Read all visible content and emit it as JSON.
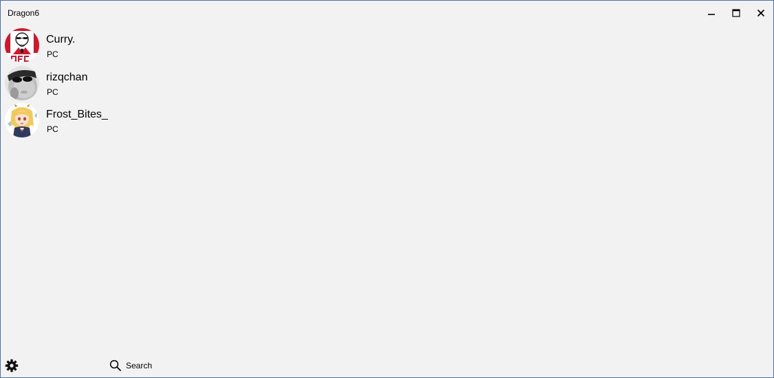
{
  "window": {
    "title": "Dragon6",
    "controls": [
      "minimize-icon",
      "maximize-icon",
      "close-icon"
    ]
  },
  "contacts": [
    {
      "name": "Curry.",
      "platform": "PC",
      "avatar": "kfc-colonel-logo"
    },
    {
      "name": "rizqchan",
      "platform": "PC",
      "avatar": "grayscale-face-photo"
    },
    {
      "name": "Frost_Bites_",
      "platform": "PC",
      "avatar": "anime-dragon-girl"
    }
  ],
  "bottom_bar": {
    "settings_icon": "gear-icon",
    "search_icon": "search-icon",
    "search_label": "Search"
  },
  "colors": {
    "background": "#f2f2f2",
    "window_border": "#4a6ea8",
    "text": "#000000"
  }
}
